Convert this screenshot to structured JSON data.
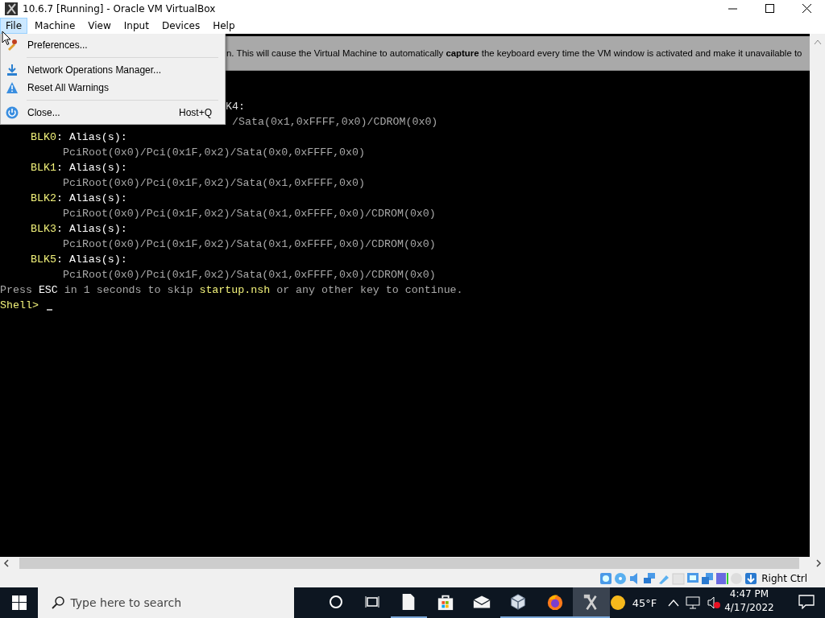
{
  "window": {
    "title": "10.6.7 [Running] - Oracle VM VirtualBox"
  },
  "menu_bar": [
    {
      "label": "File",
      "selected": true
    },
    {
      "label": "Machine",
      "selected": false
    },
    {
      "label": "View",
      "selected": false
    },
    {
      "label": "Input",
      "selected": false
    },
    {
      "label": "Devices",
      "selected": false
    },
    {
      "label": "Help",
      "selected": false
    }
  ],
  "file_menu": [
    {
      "kind": "item",
      "label": "Preferences..."
    },
    {
      "kind": "separator"
    },
    {
      "kind": "item",
      "label": "Network Operations Manager..."
    },
    {
      "kind": "item",
      "label": "Reset All Warnings"
    },
    {
      "kind": "separator"
    },
    {
      "kind": "item",
      "label": "Close...",
      "shortcut": "Host+Q"
    }
  ],
  "notification": {
    "text": "n. This will cause the Virtual Machine to automatically **capture** the keyboard every time the VM window is activated and make it unavailable to"
  },
  "terminal": [
    {
      "kind": "covered_header",
      "segments": [
        {
          "text": "K4:",
          "color": "#e0e0e0"
        }
      ]
    },
    {
      "kind": "covered_path",
      "segments": [
        {
          "text": "/Sata(0x1,0xFFFF,0x0)/CDROM(0x0)",
          "color": "#a8a8a8"
        }
      ]
    },
    {
      "kind": "header",
      "segments": [
        {
          "text": "BLK0",
          "color": "#f2f27a"
        },
        {
          "text": ": Alias(s):",
          "color": "#ffffff"
        }
      ]
    },
    {
      "kind": "path",
      "segments": [
        {
          "text": "PciRoot(0x0)/Pci(0x1F,0x2)/Sata(0x0,0xFFFF,0x0)",
          "color": "#a8a8a8"
        }
      ]
    },
    {
      "kind": "header",
      "segments": [
        {
          "text": "BLK1",
          "color": "#f2f27a"
        },
        {
          "text": ": Alias(s):",
          "color": "#ffffff"
        }
      ]
    },
    {
      "kind": "path",
      "segments": [
        {
          "text": "PciRoot(0x0)/Pci(0x1F,0x2)/Sata(0x1,0xFFFF,0x0)",
          "color": "#a8a8a8"
        }
      ]
    },
    {
      "kind": "header",
      "segments": [
        {
          "text": "BLK2",
          "color": "#f2f27a"
        },
        {
          "text": ": Alias(s):",
          "color": "#ffffff"
        }
      ]
    },
    {
      "kind": "path",
      "segments": [
        {
          "text": "PciRoot(0x0)/Pci(0x1F,0x2)/Sata(0x1,0xFFFF,0x0)/CDROM(0x0)",
          "color": "#a8a8a8"
        }
      ]
    },
    {
      "kind": "header",
      "segments": [
        {
          "text": "BLK3",
          "color": "#f2f27a"
        },
        {
          "text": ": Alias(s):",
          "color": "#ffffff"
        }
      ]
    },
    {
      "kind": "path",
      "segments": [
        {
          "text": "PciRoot(0x0)/Pci(0x1F,0x2)/Sata(0x1,0xFFFF,0x0)/CDROM(0x0)",
          "color": "#a8a8a8"
        }
      ]
    },
    {
      "kind": "header",
      "segments": [
        {
          "text": "BLK5",
          "color": "#f2f27a"
        },
        {
          "text": ": Alias(s):",
          "color": "#ffffff"
        }
      ]
    },
    {
      "kind": "path",
      "segments": [
        {
          "text": "PciRoot(0x0)/Pci(0x1F,0x2)/Sata(0x1,0xFFFF,0x0)/CDROM(0x0)",
          "color": "#a8a8a8"
        }
      ]
    },
    {
      "kind": "message",
      "segments": [
        {
          "text": "Press ",
          "color": "#a8a8a8"
        },
        {
          "text": "ESC",
          "color": "#ffffff"
        },
        {
          "text": " in 1 seconds to skip ",
          "color": "#a8a8a8"
        },
        {
          "text": "startup.nsh",
          "color": "#f2f27a"
        },
        {
          "text": " or any other key to continue.",
          "color": "#a8a8a8"
        }
      ]
    },
    {
      "kind": "prompt",
      "segments": [
        {
          "text": "Shell>",
          "color": "#f2f27a"
        }
      ]
    }
  ],
  "status_bar": {
    "host_key": "Right Ctrl"
  },
  "taskbar": {
    "search": {
      "placeholder": "Type here to search"
    },
    "apps": [
      {
        "kind": "file",
        "running": true,
        "selected": false
      },
      {
        "kind": "store",
        "running": false,
        "selected": false
      },
      {
        "kind": "mail",
        "running": false,
        "selected": false
      },
      {
        "kind": "virtualbox",
        "running": true,
        "selected": false
      },
      {
        "kind": "firefox",
        "running": true,
        "selected": false
      },
      {
        "kind": "vm",
        "running": true,
        "selected": true
      }
    ],
    "weather": "45°F",
    "time": "4:47 PM",
    "date": "4/17/2022"
  }
}
